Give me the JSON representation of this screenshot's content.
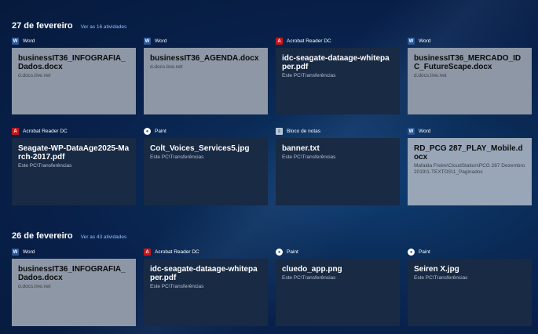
{
  "groups": [
    {
      "date": "27 de fevereiro",
      "link": "Ver as 16 atividades",
      "cards": [
        {
          "app": "Word",
          "icon": "word-icon",
          "title": "businessIT36_INFOGRAFIA_Dados.docx",
          "sub": "d.docs.live.net"
        },
        {
          "app": "Word",
          "icon": "word-icon",
          "title": "businessIT36_AGENDA.docx",
          "sub": "d.docs.live.net"
        },
        {
          "app": "Acrobat Reader DC",
          "icon": "acrobat-icon",
          "title": "idc-seagate-dataage-whitepaper.pdf",
          "sub": "Este PC\\Transferências"
        },
        {
          "app": "Word",
          "icon": "word-icon",
          "title": "businessIT36_MERCADO_IDC_FutureScape.docx",
          "sub": "d.docs.live.net"
        },
        {
          "app": "Acrobat Reader DC",
          "icon": "acrobat-icon",
          "title": "Seagate-WP-DataAge2025-March-2017.pdf",
          "sub": "Este PC\\Transferências"
        },
        {
          "app": "Paint",
          "icon": "paint-icon",
          "title": "Colt_Voices_Services5.jpg",
          "sub": "Este PC\\Transferências"
        },
        {
          "app": "Bloco de notas",
          "icon": "notepad-icon",
          "title": "banner.txt",
          "sub": "Este PC\\Transferências"
        },
        {
          "app": "Word",
          "icon": "word-icon",
          "title": "RD_PCG 287_PLAY_Mobile.docx",
          "sub": "Mafalda Freire\\CloudStation\\PCG 287 Dezembro 2019\\1-TEXTOS\\1_Paginados"
        }
      ]
    },
    {
      "date": "26 de fevereiro",
      "link": "Ver as 43 atividades",
      "cards": [
        {
          "app": "Word",
          "icon": "word-icon",
          "title": "businessIT36_INFOGRAFIA_Dados.docx",
          "sub": "d.docs.live.net"
        },
        {
          "app": "Acrobat Reader DC",
          "icon": "acrobat-icon",
          "title": "idc-seagate-dataage-whitepaper.pdf",
          "sub": "Este PC\\Transferências"
        },
        {
          "app": "Paint",
          "icon": "paint-icon",
          "title": "cluedo_app.png",
          "sub": "Este PC\\Transferências"
        },
        {
          "app": "Paint",
          "icon": "paint-icon",
          "title": "Seiren X.jpg",
          "sub": "Este PC\\Transferências"
        }
      ]
    }
  ]
}
